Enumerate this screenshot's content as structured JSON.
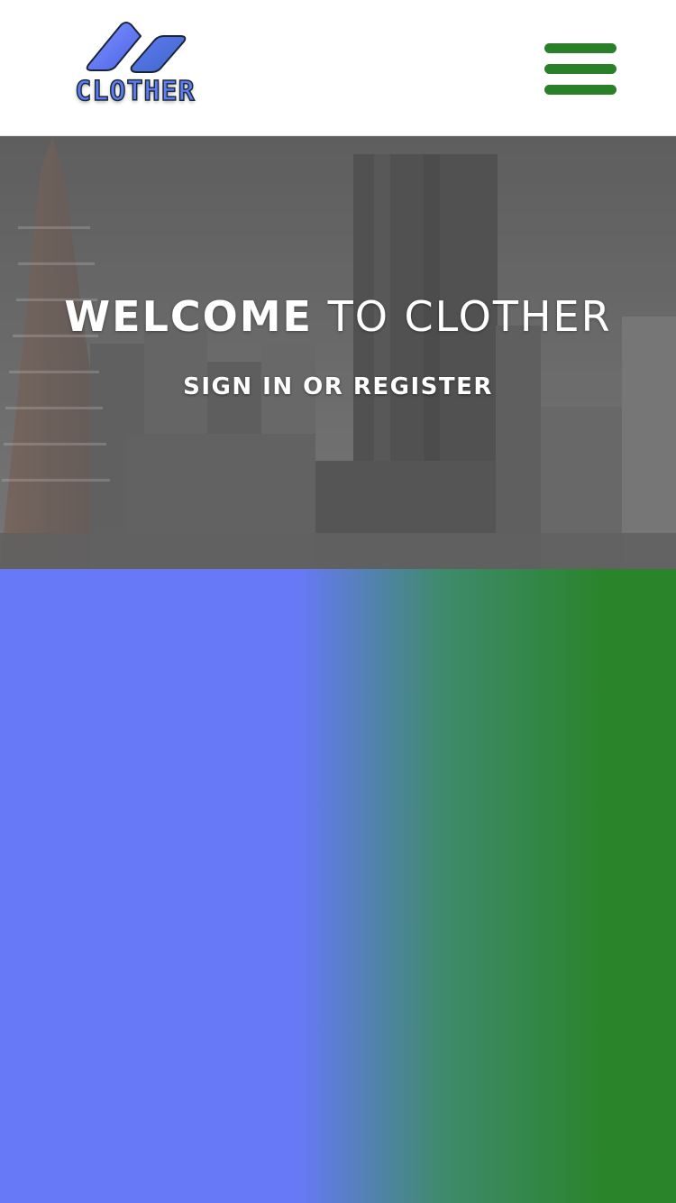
{
  "header": {
    "logo": {
      "text": "CLOTHER",
      "icon": "clother-logo-icon"
    },
    "menu_icon": "hamburger-menu-icon"
  },
  "hero": {
    "title_strong": "WELCOME",
    "title_rest": "TO CLOTHER",
    "link_label": "SIGN IN OR REGISTER"
  },
  "colors": {
    "brand_green": "#2a8029",
    "brand_blue": "#6779f7",
    "header_bg": "#ffffff"
  }
}
